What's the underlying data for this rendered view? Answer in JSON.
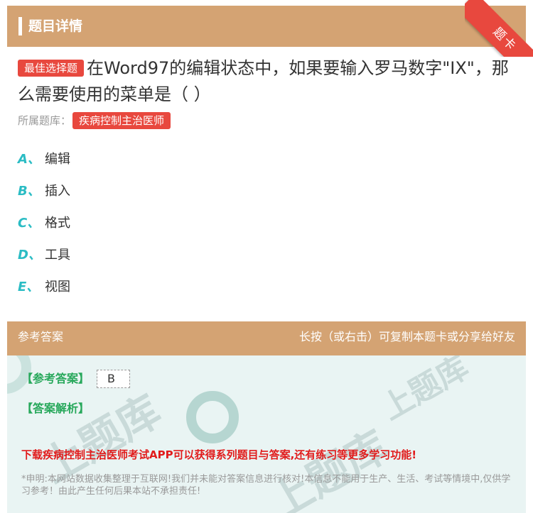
{
  "header": {
    "title": "题目详情",
    "ribbon": "题卡"
  },
  "question": {
    "type_badge": "最佳选择题",
    "text": "在Word97的编辑状态中，如果要输入罗马数字\"IX\"，那么需要使用的菜单是（ ）",
    "bank_label": "所属题库：",
    "bank_name": "疾病控制主治医师"
  },
  "options": [
    {
      "letter": "A、",
      "text": "编辑"
    },
    {
      "letter": "B、",
      "text": "插入"
    },
    {
      "letter": "C、",
      "text": "格式"
    },
    {
      "letter": "D、",
      "text": "工具"
    },
    {
      "letter": "E、",
      "text": "视图"
    }
  ],
  "answer_section": {
    "title": "参考答案",
    "hint": "长按（或右击）可复制本题卡或分享给好友",
    "ref_label": "【参考答案】",
    "ref_value": "B",
    "analysis_label": "【答案解析】",
    "promo": "下载疾病控制主治医师考试APP可以获得系列题目与答案,还有练习等更多学习功能!",
    "disclaimer": "*申明:本网站数据收集整理于互联网!我们并未能对答案信息进行核对!本信息不能用于生产、生活、考试等情境中,仅供学习参考！由此产生任何后果本站不承担责任!"
  },
  "colors": {
    "header_bg": "#d4a373",
    "accent_red": "#e8483e",
    "option_letter": "#2bbcc4",
    "answer_green": "#27a85b",
    "answer_bg": "#e9f4f3"
  }
}
